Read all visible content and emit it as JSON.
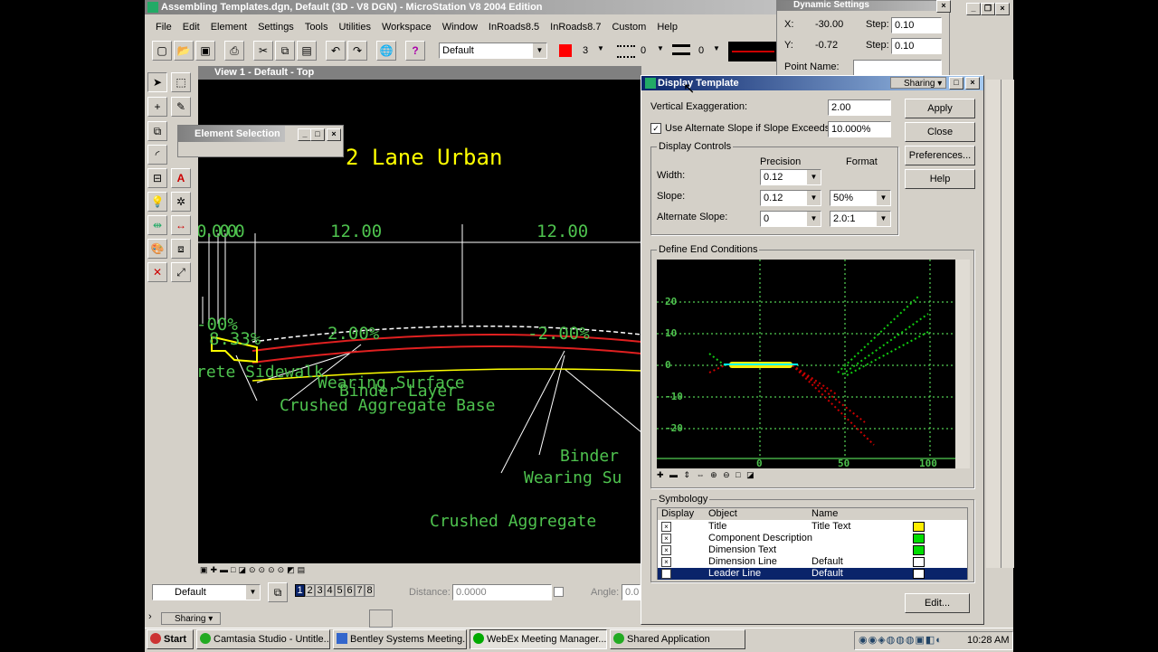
{
  "app": {
    "title": "Assembling Templates.dgn, Default (3D - V8 DGN) - MicroStation V8 2004 Edition",
    "menu": [
      "File",
      "Edit",
      "Element",
      "Settings",
      "Tools",
      "Utilities",
      "Workspace",
      "Window",
      "InRoads8.5",
      "InRoads8.7",
      "Custom",
      "Help"
    ],
    "level_combo": "Default",
    "color_value": "3",
    "style_value": "0",
    "weight_value": "0"
  },
  "view": {
    "title": "View 1 - Default - Top",
    "cad_title": "2 Lane Urban",
    "dim_left": "0.0000",
    "dim_12a": "12.00",
    "dim_12b": "12.00",
    "pct_left": "-00%",
    "pct_833": "8.33%",
    "pct_200": "2.00%",
    "pct_n200": "-2.00%",
    "lbl_sidewalk": "rete Sidewalk",
    "lbl_wearing": "Wearing Surface",
    "lbl_binder": "Binder Layer",
    "lbl_crushed": "Crushed Aggregate Base",
    "lbl_binder2": "Binder",
    "lbl_wearing2": "Wearing Su",
    "lbl_crushed2": "Crushed Aggregate"
  },
  "element_selection": {
    "title": "Element Selection"
  },
  "dynamic_settings": {
    "title": "Dynamic Settings",
    "x_label": "X:",
    "x_value": "-30.00",
    "y_label": "Y:",
    "y_value": "-0.72",
    "step_label": "Step:",
    "step_x": "0.10",
    "step_y": "0.10",
    "point_name_label": "Point Name:"
  },
  "display_template": {
    "title": "Display Template",
    "sharing": "Sharing",
    "vert_exag_label": "Vertical Exaggeration:",
    "vert_exag_value": "2.00",
    "alt_slope_label": "Use Alternate Slope if Slope Exceeds:",
    "alt_slope_value": "10.000%",
    "buttons": {
      "apply": "Apply",
      "close": "Close",
      "preferences": "Preferences...",
      "help": "Help",
      "edit": "Edit..."
    },
    "display_controls_label": "Display Controls",
    "precision_label": "Precision",
    "format_label": "Format",
    "width_label": "Width:",
    "width_precision": "0.12",
    "slope_label": "Slope:",
    "slope_precision": "0.12",
    "slope_format": "50%",
    "alt_slope_row_label": "Alternate Slope:",
    "alt_precision": "0",
    "alt_format": "2.0:1",
    "end_conditions_label": "Define End Conditions",
    "plot_y_ticks": [
      "20",
      "10",
      "0",
      "-10",
      "-20"
    ],
    "plot_x_ticks": [
      "0",
      "50",
      "100"
    ],
    "symbology_label": "Symbology",
    "sym_headers": [
      "Display",
      "Object",
      "Name"
    ],
    "sym_rows": [
      {
        "object": "Title",
        "name": "Title Text",
        "color": "#ffee00"
      },
      {
        "object": "Component Description",
        "name": "",
        "color": "#00dd00"
      },
      {
        "object": "Dimension Text",
        "name": "",
        "color": "#00dd00"
      },
      {
        "object": "Dimension Line",
        "name": "Default",
        "color": "#ffffff"
      },
      {
        "object": "Leader Line",
        "name": "Default",
        "color": "#ffffff"
      }
    ]
  },
  "status": {
    "level": "Default",
    "view_nums": [
      "1",
      "2",
      "3",
      "4",
      "5",
      "6",
      "7",
      "8"
    ],
    "distance_label": "Distance:",
    "distance_value": "0.0000",
    "angle_label": "Angle:",
    "angle_value": "0.0",
    "sharing": "Sharing"
  },
  "taskbar": {
    "start": "Start",
    "items": [
      "Camtasia Studio - Untitle...",
      "Bentley Systems Meeting...",
      "WebEx Meeting Manager...",
      "Shared Application"
    ],
    "clock": "10:28 AM"
  }
}
